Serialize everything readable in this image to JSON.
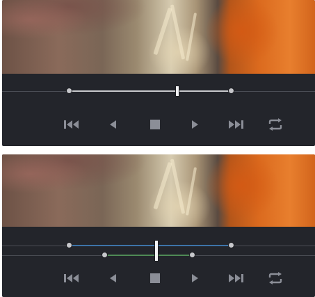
{
  "colors": {
    "panel_bg": "#23252b",
    "icon": "#8b8e97",
    "track_white": "#c9cacd",
    "in_out_track_blue": "#3d73a8",
    "in_out_track_green": "#4f8a55",
    "playhead": "#f3f4f6",
    "hairline": "#4a4d55"
  },
  "viewers": [
    {
      "scrubber": {
        "tracks": [
          {
            "color": "#c9cacd",
            "range": [
              0.0,
              1.0
            ]
          }
        ],
        "playhead_position": 0.63
      },
      "transport": [
        {
          "name": "jump-to-start",
          "icon": "jump-to-start-icon"
        },
        {
          "name": "play-reverse",
          "icon": "play-reverse-icon"
        },
        {
          "name": "stop",
          "icon": "stop-icon"
        },
        {
          "name": "play-forward",
          "icon": "play-forward-icon"
        },
        {
          "name": "jump-to-end",
          "icon": "jump-to-end-icon"
        },
        {
          "name": "loop",
          "icon": "loop-icon"
        }
      ]
    },
    {
      "scrubber": {
        "tracks": [
          {
            "color": "#3d73a8",
            "range": [
              0.0,
              1.0
            ]
          },
          {
            "color": "#4f8a55",
            "range": [
              0.22,
              0.76
            ]
          }
        ],
        "playhead_position": 0.53
      },
      "transport": [
        {
          "name": "jump-to-start",
          "icon": "jump-to-start-icon"
        },
        {
          "name": "play-reverse",
          "icon": "play-reverse-icon"
        },
        {
          "name": "stop",
          "icon": "stop-icon"
        },
        {
          "name": "play-forward",
          "icon": "play-forward-icon"
        },
        {
          "name": "jump-to-end",
          "icon": "jump-to-end-icon"
        },
        {
          "name": "loop",
          "icon": "loop-icon"
        }
      ]
    }
  ]
}
